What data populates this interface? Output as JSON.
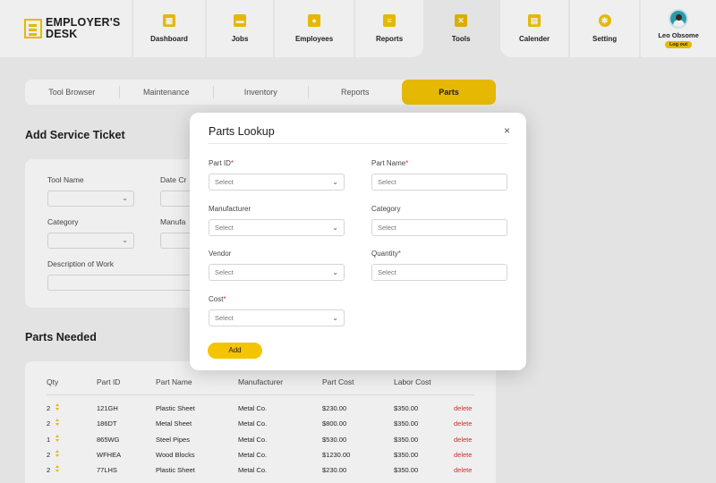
{
  "brand": {
    "line1": "EMPLOYER'S",
    "line2": "DESK"
  },
  "nav": [
    {
      "label": "Dashboard",
      "icon": "dashboard-icon"
    },
    {
      "label": "Jobs",
      "icon": "briefcase-icon"
    },
    {
      "label": "Employees",
      "icon": "people-icon"
    },
    {
      "label": "Reports",
      "icon": "report-icon"
    },
    {
      "label": "Tools",
      "icon": "tools-icon"
    },
    {
      "label": "Calender",
      "icon": "calendar-icon"
    },
    {
      "label": "Setting",
      "icon": "gear-icon"
    }
  ],
  "user": {
    "name": "Leo Obsome",
    "logout": "Log out"
  },
  "tabs": [
    "Tool Browser",
    "Maintenance",
    "Inventory",
    "Reports",
    "Parts"
  ],
  "service": {
    "title": "Add Service Ticket",
    "tool_name": "Tool Name",
    "date_created": "Date Cr",
    "category": "Category",
    "manufacturer": "Manufa",
    "description": "Description of Work"
  },
  "parts_needed": {
    "title": "Parts Needed",
    "columns": [
      "Qty",
      "Part ID",
      "Part Name",
      "Manufacturer",
      "Part Cost",
      "Labor Cost"
    ],
    "rows": [
      {
        "qty": "2",
        "part_id": "121GH",
        "name": "Plastic Sheet",
        "manufacturer": "Metal Co.",
        "part_cost": "$230.00",
        "labor_cost": "$350.00",
        "action": "delete"
      },
      {
        "qty": "2",
        "part_id": "186DT",
        "name": "Metal Sheet",
        "manufacturer": "Metal Co.",
        "part_cost": "$800.00",
        "labor_cost": "$350.00",
        "action": "delete"
      },
      {
        "qty": "1",
        "part_id": "865WG",
        "name": "Steel Pipes",
        "manufacturer": "Metal Co.",
        "part_cost": "$530.00",
        "labor_cost": "$350.00",
        "action": "delete"
      },
      {
        "qty": "2",
        "part_id": "WFHEA",
        "name": "Wood Blocks",
        "manufacturer": "Metal Co.",
        "part_cost": "$1230.00",
        "labor_cost": "$350.00",
        "action": "delete"
      },
      {
        "qty": "2",
        "part_id": "77LHS",
        "name": "Plastic Sheet",
        "manufacturer": "Metal Co.",
        "part_cost": "$230.00",
        "labor_cost": "$350.00",
        "action": "delete"
      }
    ]
  },
  "modal": {
    "title": "Parts Lookup",
    "close": "×",
    "fields": {
      "part_id": {
        "label": "Part ID",
        "placeholder": "Select"
      },
      "part_name": {
        "label": "Part Name",
        "placeholder": "Select"
      },
      "manufacturer": {
        "label": "Manufacturer",
        "placeholder": "Select"
      },
      "category": {
        "label": "Category",
        "placeholder": "Select"
      },
      "vendor": {
        "label": "Vendor",
        "placeholder": "Select"
      },
      "quantity": {
        "label": "Quantity",
        "placeholder": "Select"
      },
      "cost": {
        "label": "Cost",
        "placeholder": "Select"
      }
    },
    "required_mark": "*",
    "add_label": "Add"
  },
  "colors": {
    "accent": "#f5c400",
    "danger": "#d93030"
  }
}
